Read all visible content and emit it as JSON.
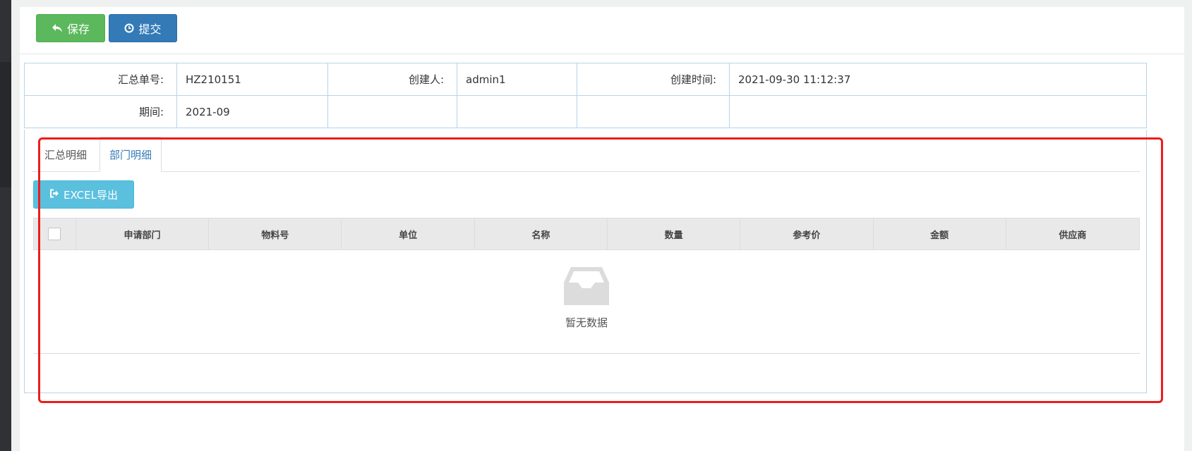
{
  "toolbar": {
    "save_label": "保存",
    "submit_label": "提交"
  },
  "info": {
    "summary_no_label": "汇总单号:",
    "summary_no": "HZ210151",
    "creator_label": "创建人:",
    "creator": "admin1",
    "created_time_label": "创建时间:",
    "created_time": "2021-09-30 11:12:37",
    "period_label": "期间:",
    "period": "2021-09"
  },
  "tabs": [
    {
      "label": "汇总明细"
    },
    {
      "label": "部门明细",
      "active": true
    }
  ],
  "export_label": "EXCEL导出",
  "table": {
    "columns": [
      "申请部门",
      "物料号",
      "单位",
      "名称",
      "数量",
      "参考价",
      "金额",
      "供应商"
    ],
    "rows": [],
    "empty_text": "暂无数据"
  },
  "icons": {
    "save": "reply-icon",
    "submit": "clock-icon",
    "export": "sign-out-icon",
    "empty": "inbox-icon"
  },
  "colors": {
    "save_button": "#5cb85c",
    "submit_button": "#337ab7",
    "export_button": "#5bc0de",
    "highlight": "#ee1c1c"
  }
}
